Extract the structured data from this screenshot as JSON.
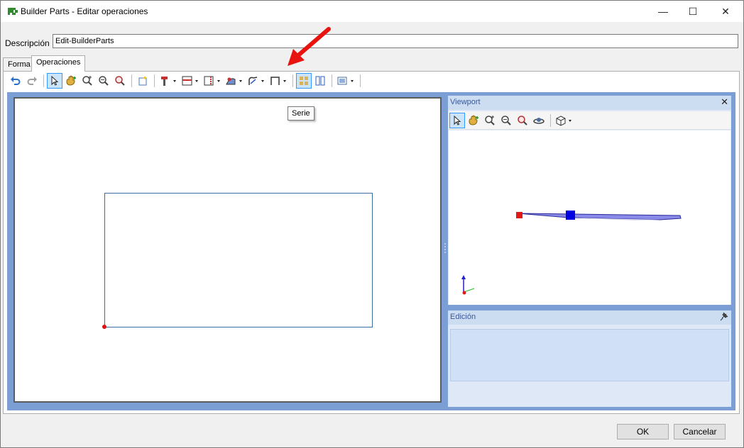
{
  "window": {
    "title": "Builder Parts - Editar operaciones",
    "icons": {
      "app": "green-piece-icon",
      "minimize": "minimize-icon",
      "maximize": "maximize-icon",
      "close": "close-icon"
    },
    "glyphs": {
      "minimize": "—",
      "maximize": "☐",
      "close": "✕"
    }
  },
  "description": {
    "label": "Descripción",
    "value": "Edit-BuilderParts"
  },
  "tabs": [
    {
      "label": "Forma",
      "active": false
    },
    {
      "label": "Operaciones",
      "active": true
    }
  ],
  "toolbar": {
    "items": [
      "undo-icon",
      "redo-icon",
      "|",
      "select-pointer-icon",
      "pan-hand-icon",
      "zoom-in-icon",
      "zoom-out-icon",
      "zoom-extents-icon",
      "|",
      "new-operation-icon",
      "|",
      "drill-dropdown-icon",
      "pocket-dropdown-icon",
      "profile-dropdown-icon",
      "cut-dropdown-icon",
      "path-dropdown-icon",
      "frame-dropdown-icon",
      "serie-icon",
      "split-icon",
      "|",
      "view-options-dropdown-icon"
    ],
    "selected": [
      "select-pointer-icon",
      "serie-icon"
    ],
    "tooltip": "Serie"
  },
  "viewport": {
    "title": "Viewport",
    "close_glyph": "✕",
    "toolbar": [
      "select-pointer-icon",
      "pan-hand-icon",
      "zoom-in-icon",
      "zoom-out-icon",
      "zoom-extents-icon",
      "orbit-icon",
      "|",
      "3d-cube-dropdown-icon"
    ]
  },
  "edicion": {
    "title": "Edición",
    "pin_icon": "pin-icon"
  },
  "buttons": {
    "ok": "OK",
    "cancel": "Cancelar"
  },
  "colors": {
    "accent": "#7b9ed5",
    "origin_point": "#e01010",
    "annotation_arrow": "#e8130f",
    "part_handle": "#0000e0"
  }
}
